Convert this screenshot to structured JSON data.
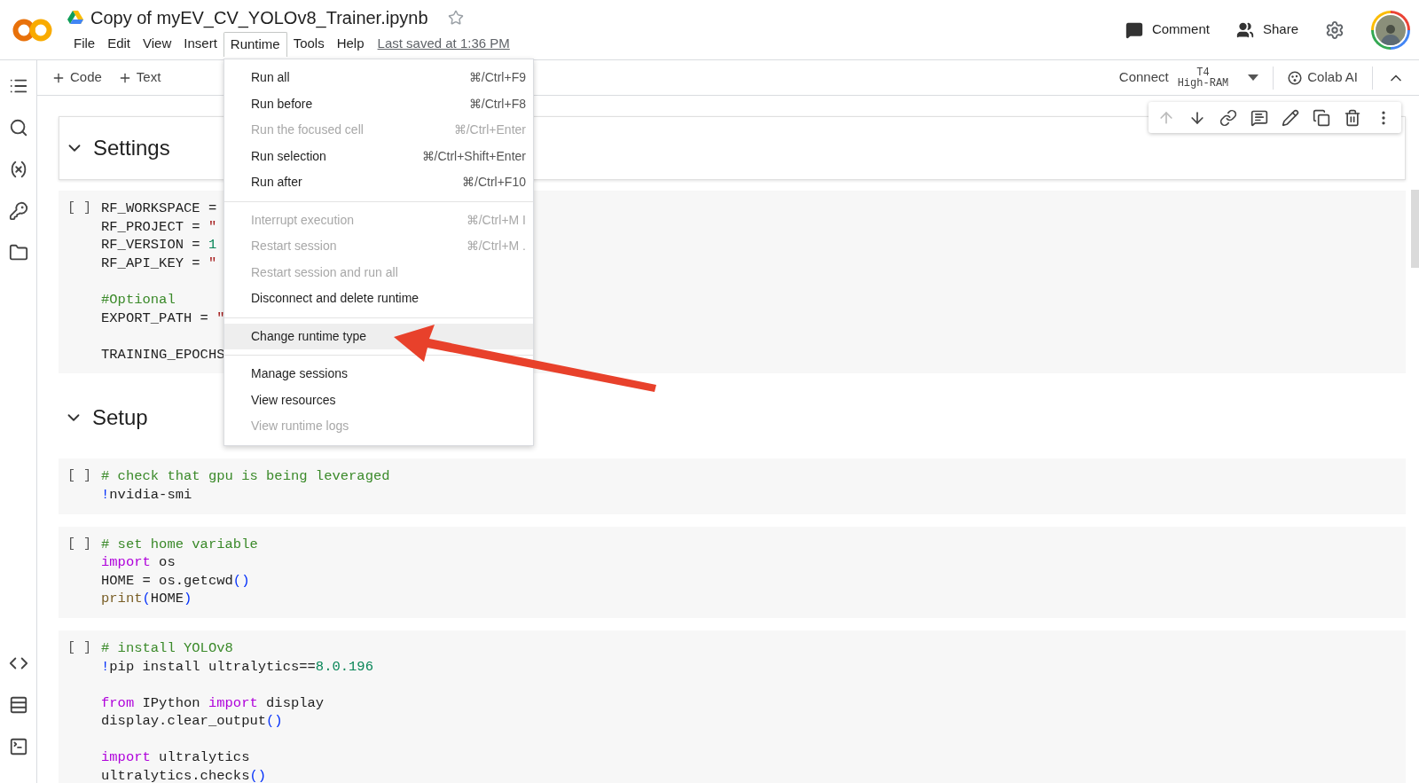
{
  "header": {
    "title": "Copy of myEV_CV_YOLOv8_Trainer.ipynb",
    "starred": false,
    "menus": [
      {
        "label": "File",
        "selected": false
      },
      {
        "label": "Edit",
        "selected": false
      },
      {
        "label": "View",
        "selected": false
      },
      {
        "label": "Insert",
        "selected": false
      },
      {
        "label": "Runtime",
        "selected": true
      },
      {
        "label": "Tools",
        "selected": false
      },
      {
        "label": "Help",
        "selected": false
      }
    ],
    "last_saved": "Last saved at 1:36 PM",
    "actions": [
      {
        "label": "Comment",
        "kind": "comment"
      },
      {
        "label": "Share",
        "kind": "share"
      }
    ]
  },
  "toolbar": {
    "add_buttons": [
      "Code",
      "Text"
    ],
    "connect": "Connect",
    "gpu": "T4",
    "ram": "High-RAM",
    "ai": "Colab AI"
  },
  "sections": [
    {
      "title": "Settings",
      "expanded": true,
      "selected": true,
      "cells": [
        {
          "prompt": "[ ]",
          "blocks": [
            [
              [
                {
                  "kind": "plain",
                  "t": "RF_WORKSPACE ="
                }
              ],
              [
                {
                  "kind": "plain",
                  "t": "RF_PROJECT = "
                },
                {
                  "kind": "string",
                  "t": "\""
                }
              ],
              [
                {
                  "kind": "plain",
                  "t": "RF_VERSION = "
                },
                {
                  "kind": "number",
                  "t": "1"
                }
              ],
              [
                {
                  "kind": "plain",
                  "t": "RF_API_KEY = "
                },
                {
                  "kind": "string",
                  "t": "\""
                }
              ]
            ],
            [
              [
                {
                  "kind": "comment",
                  "t": "#Optional"
                }
              ],
              [
                {
                  "kind": "plain",
                  "t": "EXPORT_PATH = "
                },
                {
                  "kind": "string",
                  "t": "\""
                }
              ]
            ],
            [
              [
                {
                  "kind": "plain",
                  "t": "TRAINING_EPOCHS"
                }
              ]
            ]
          ]
        }
      ]
    },
    {
      "title": "Setup",
      "expanded": true,
      "selected": false,
      "cells": [
        {
          "prompt": "[ ]",
          "blocks": [
            [
              [
                {
                  "kind": "comment",
                  "t": "# check that gpu is being leveraged"
                }
              ],
              [
                {
                  "kind": "paren",
                  "t": "!"
                },
                {
                  "kind": "plain",
                  "t": "nvidia-smi"
                }
              ]
            ]
          ]
        },
        {
          "prompt": "[ ]",
          "blocks": [
            [
              [
                {
                  "kind": "comment",
                  "t": "# set home variable"
                }
              ],
              [
                {
                  "kind": "keyword",
                  "t": "import"
                },
                {
                  "kind": "plain",
                  "t": " os"
                }
              ],
              [
                {
                  "kind": "plain",
                  "t": "HOME = os.getcwd"
                },
                {
                  "kind": "paren",
                  "t": "()"
                }
              ],
              [
                {
                  "kind": "builtin",
                  "t": "print"
                },
                {
                  "kind": "paren",
                  "t": "("
                },
                {
                  "kind": "plain",
                  "t": "HOME"
                },
                {
                  "kind": "paren",
                  "t": ")"
                }
              ]
            ]
          ]
        },
        {
          "prompt": "[ ]",
          "blocks": [
            [
              [
                {
                  "kind": "comment",
                  "t": "# install YOLOv8"
                }
              ],
              [
                {
                  "kind": "paren",
                  "t": "!"
                },
                {
                  "kind": "plain",
                  "t": "pip install ultralytics=="
                },
                {
                  "kind": "number",
                  "t": "8.0.196"
                }
              ]
            ],
            [
              [
                {
                  "kind": "keyword",
                  "t": "from"
                },
                {
                  "kind": "plain",
                  "t": " IPython "
                },
                {
                  "kind": "keyword",
                  "t": "import"
                },
                {
                  "kind": "plain",
                  "t": " display"
                }
              ],
              [
                {
                  "kind": "plain",
                  "t": "display.clear_output"
                },
                {
                  "kind": "paren",
                  "t": "()"
                }
              ]
            ],
            [
              [
                {
                  "kind": "keyword",
                  "t": "import"
                },
                {
                  "kind": "plain",
                  "t": " ultralytics"
                }
              ],
              [
                {
                  "kind": "plain",
                  "t": "ultralytics.checks"
                },
                {
                  "kind": "paren",
                  "t": "()"
                }
              ]
            ]
          ]
        }
      ]
    }
  ],
  "runtime_menu": {
    "groups": [
      [
        {
          "label": "Run all",
          "shortcut": "⌘/Ctrl+F9",
          "disabled": false,
          "selected": false
        },
        {
          "label": "Run before",
          "shortcut": "⌘/Ctrl+F8",
          "disabled": false,
          "selected": false
        },
        {
          "label": "Run the focused cell",
          "shortcut": "⌘/Ctrl+Enter",
          "disabled": true,
          "selected": false
        },
        {
          "label": "Run selection",
          "shortcut": "⌘/Ctrl+Shift+Enter",
          "disabled": false,
          "selected": false
        },
        {
          "label": "Run after",
          "shortcut": "⌘/Ctrl+F10",
          "disabled": false,
          "selected": false
        }
      ],
      [
        {
          "label": "Interrupt execution",
          "shortcut": "⌘/Ctrl+M I",
          "disabled": true,
          "selected": false
        },
        {
          "label": "Restart session",
          "shortcut": "⌘/Ctrl+M .",
          "disabled": true,
          "selected": false
        },
        {
          "label": "Restart session and run all",
          "disabled": true,
          "selected": false
        },
        {
          "label": "Disconnect and delete runtime",
          "disabled": false,
          "selected": false
        }
      ],
      [
        {
          "label": "Change runtime type",
          "disabled": false,
          "selected": true
        }
      ],
      [
        {
          "label": "Manage sessions",
          "disabled": false,
          "selected": false
        },
        {
          "label": "View resources",
          "disabled": false,
          "selected": false
        },
        {
          "label": "View runtime logs",
          "disabled": true,
          "selected": false
        }
      ]
    ]
  }
}
